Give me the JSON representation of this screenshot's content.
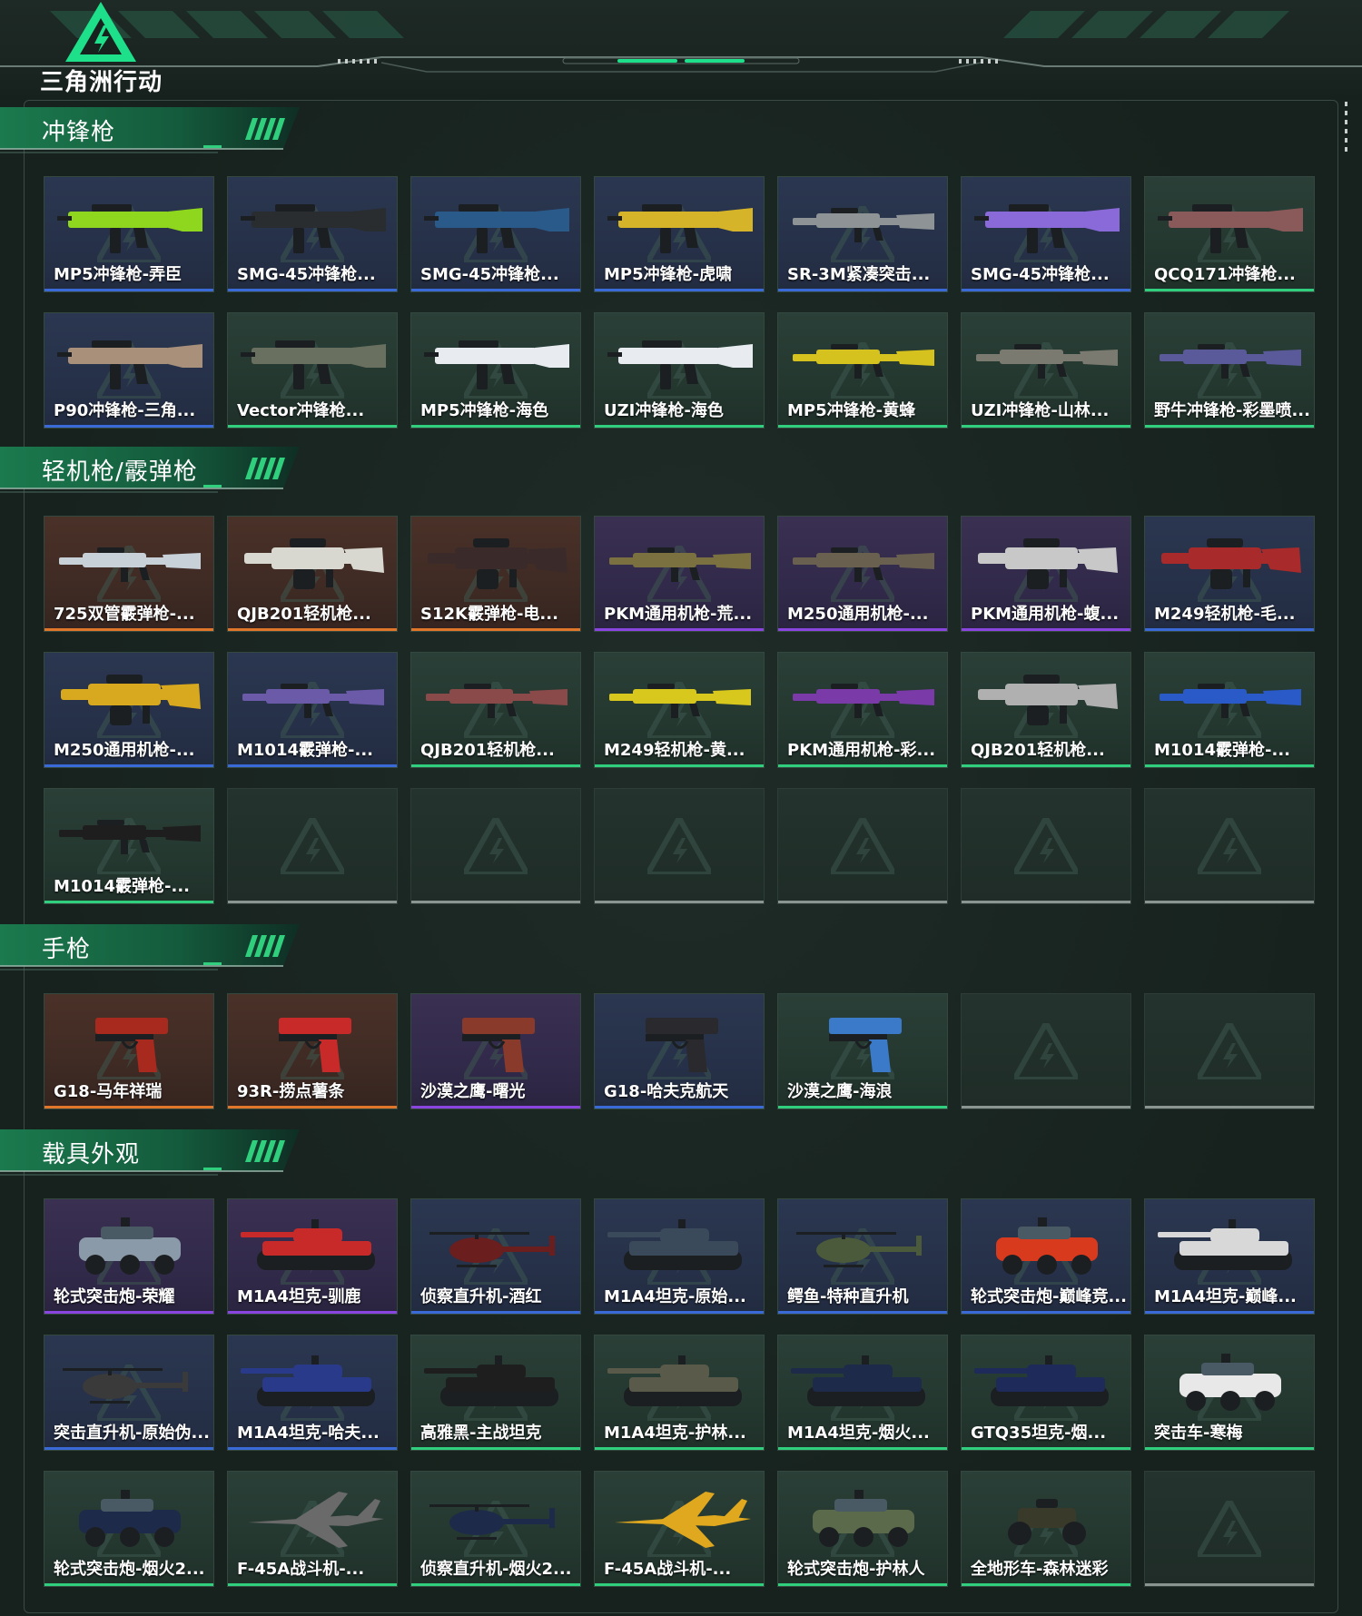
{
  "logo": {
    "text": "三角洲行动"
  },
  "colors": {
    "blue": "#3a6ad8",
    "purple": "#8a44e0",
    "orange": "#e0762a",
    "green": "#2fcf7d",
    "empty": "#8a9490",
    "accent": "#1ee08a"
  },
  "sections": [
    {
      "title": "冲锋枪",
      "items": [
        {
          "label": "MP5冲锋枪-弄臣",
          "quality": "blue",
          "kind": "smg",
          "tint": "#8fd61e"
        },
        {
          "label": "SMG-45冲锋枪...",
          "quality": "blue",
          "kind": "smg",
          "tint": "#2a2d30"
        },
        {
          "label": "SMG-45冲锋枪...",
          "quality": "blue",
          "kind": "smg",
          "tint": "#2a5a8a"
        },
        {
          "label": "MP5冲锋枪-虎啸",
          "quality": "blue",
          "kind": "smg",
          "tint": "#d6b42a"
        },
        {
          "label": "SR-3M紧凑突击...",
          "quality": "blue",
          "kind": "rifle",
          "tint": "#8e9496"
        },
        {
          "label": "SMG-45冲锋枪...",
          "quality": "blue",
          "kind": "smg",
          "tint": "#8a6ad8"
        },
        {
          "label": "QCQ171冲锋枪...",
          "quality": "green",
          "kind": "smg",
          "tint": "#8a5a5a"
        },
        {
          "label": "P90冲锋枪-三角...",
          "quality": "blue",
          "kind": "smg",
          "tint": "#a8907a"
        },
        {
          "label": "Vector冲锋枪...",
          "quality": "green",
          "kind": "smg",
          "tint": "#6a7060"
        },
        {
          "label": "MP5冲锋枪-海色",
          "quality": "green",
          "kind": "smg",
          "tint": "#e8ecf0"
        },
        {
          "label": "UZI冲锋枪-海色",
          "quality": "green",
          "kind": "smg",
          "tint": "#e8ecf0"
        },
        {
          "label": "MP5冲锋枪-黄蜂",
          "quality": "green",
          "kind": "rifle",
          "tint": "#d6c21e"
        },
        {
          "label": "UZI冲锋枪-山林...",
          "quality": "green",
          "kind": "rifle",
          "tint": "#7a7a70"
        },
        {
          "label": "野牛冲锋枪-彩墨喷...",
          "quality": "green",
          "kind": "rifle",
          "tint": "#5a5a9a"
        }
      ]
    },
    {
      "title": "轻机枪/霰弹枪",
      "items": [
        {
          "label": "725双管霰弹枪-...",
          "quality": "orange",
          "kind": "rifle",
          "tint": "#c8d0d8"
        },
        {
          "label": "QJB201轻机枪...",
          "quality": "orange",
          "kind": "lmg",
          "tint": "#d8d8d0"
        },
        {
          "label": "S12K霰弹枪-电...",
          "quality": "orange",
          "kind": "lmg",
          "tint": "#3a2a2a"
        },
        {
          "label": "PKM通用机枪-荒...",
          "quality": "purple",
          "kind": "rifle",
          "tint": "#7a7040"
        },
        {
          "label": "M250通用机枪-...",
          "quality": "purple",
          "kind": "rifle",
          "tint": "#6a6050"
        },
        {
          "label": "PKM通用机枪-蝮...",
          "quality": "purple",
          "kind": "lmg",
          "tint": "#c8c8c8"
        },
        {
          "label": "M249轻机枪-毛...",
          "quality": "blue",
          "kind": "lmg",
          "tint": "#a82a2a"
        },
        {
          "label": "M250通用机枪-...",
          "quality": "blue",
          "kind": "lmg",
          "tint": "#d8a81e"
        },
        {
          "label": "M1014霰弹枪-...",
          "quality": "blue",
          "kind": "rifle",
          "tint": "#6a5aa8"
        },
        {
          "label": "QJB201轻机枪...",
          "quality": "green",
          "kind": "rifle",
          "tint": "#8a4a4a"
        },
        {
          "label": "M249轻机枪-黄...",
          "quality": "green",
          "kind": "rifle",
          "tint": "#d8c81e"
        },
        {
          "label": "PKM通用机枪-彩...",
          "quality": "green",
          "kind": "rifle",
          "tint": "#7a3aa8"
        },
        {
          "label": "QJB201轻机枪...",
          "quality": "green",
          "kind": "lmg",
          "tint": "#b0b0b0"
        },
        {
          "label": "M1014霰弹枪-...",
          "quality": "green",
          "kind": "rifle",
          "tint": "#2a5ac8"
        },
        {
          "label": "M1014霰弹枪-...",
          "quality": "green",
          "kind": "rifle",
          "tint": "#1e1e1e"
        },
        {
          "label": "",
          "quality": "empty",
          "kind": "none",
          "tint": ""
        },
        {
          "label": "",
          "quality": "empty",
          "kind": "none",
          "tint": ""
        },
        {
          "label": "",
          "quality": "empty",
          "kind": "none",
          "tint": ""
        },
        {
          "label": "",
          "quality": "empty",
          "kind": "none",
          "tint": ""
        },
        {
          "label": "",
          "quality": "empty",
          "kind": "none",
          "tint": ""
        },
        {
          "label": "",
          "quality": "empty",
          "kind": "none",
          "tint": ""
        }
      ]
    },
    {
      "title": "手枪",
      "items": [
        {
          "label": "G18-马年祥瑞",
          "quality": "orange",
          "kind": "pistol",
          "tint": "#a82a1e"
        },
        {
          "label": "93R-捞点薯条",
          "quality": "orange",
          "kind": "pistol",
          "tint": "#c82a2a"
        },
        {
          "label": "沙漠之鹰-曙光",
          "quality": "purple",
          "kind": "pistol",
          "tint": "#8a3a2a"
        },
        {
          "label": "G18-哈夫克航天",
          "quality": "blue",
          "kind": "pistol",
          "tint": "#2a2a2e"
        },
        {
          "label": "沙漠之鹰-海浪",
          "quality": "green",
          "kind": "pistol",
          "tint": "#3a7ac8"
        },
        {
          "label": "",
          "quality": "empty",
          "kind": "none",
          "tint": ""
        },
        {
          "label": "",
          "quality": "empty",
          "kind": "none",
          "tint": ""
        }
      ]
    },
    {
      "title": "载具外观",
      "items": [
        {
          "label": "轮式突击炮-荣耀",
          "quality": "purple",
          "kind": "car",
          "tint": "#8a9aa8"
        },
        {
          "label": "M1A4坦克-驯鹿",
          "quality": "purple",
          "kind": "tank",
          "tint": "#c82a2a"
        },
        {
          "label": "侦察直升机-酒红",
          "quality": "blue",
          "kind": "heli",
          "tint": "#6a1e1e"
        },
        {
          "label": "M1A4坦克-原始...",
          "quality": "blue",
          "kind": "tank",
          "tint": "#3a4a5a"
        },
        {
          "label": "鳄鱼-特种直升机",
          "quality": "blue",
          "kind": "heli",
          "tint": "#4a5a3a"
        },
        {
          "label": "轮式突击炮-巅峰竞...",
          "quality": "blue",
          "kind": "car",
          "tint": "#d83a1e"
        },
        {
          "label": "M1A4坦克-巅峰...",
          "quality": "blue",
          "kind": "tank",
          "tint": "#d8d8d8"
        },
        {
          "label": "突击直升机-原始伪...",
          "quality": "blue",
          "kind": "heli",
          "tint": "#3a3a3a"
        },
        {
          "label": "M1A4坦克-哈夫...",
          "quality": "blue",
          "kind": "tank",
          "tint": "#2a3a8a"
        },
        {
          "label": "高雅黑-主战坦克",
          "quality": "green",
          "kind": "tank",
          "tint": "#1e1e1e"
        },
        {
          "label": "M1A4坦克-护林...",
          "quality": "green",
          "kind": "tank",
          "tint": "#5a5a4a"
        },
        {
          "label": "M1A4坦克-烟火...",
          "quality": "green",
          "kind": "tank",
          "tint": "#1e2a4a"
        },
        {
          "label": "GTQ35坦克-烟...",
          "quality": "green",
          "kind": "tank",
          "tint": "#1e2a5a"
        },
        {
          "label": "突击车-寒梅",
          "quality": "green",
          "kind": "car",
          "tint": "#e8e8e8"
        },
        {
          "label": "轮式突击炮-烟火2...",
          "quality": "green",
          "kind": "car",
          "tint": "#1e2a4a"
        },
        {
          "label": "F-45A战斗机-...",
          "quality": "green",
          "kind": "jet",
          "tint": "#6a6a6a"
        },
        {
          "label": "侦察直升机-烟火2...",
          "quality": "green",
          "kind": "heli",
          "tint": "#1e2a4a"
        },
        {
          "label": "F-45A战斗机-...",
          "quality": "green",
          "kind": "jet",
          "tint": "#e0a81e"
        },
        {
          "label": "轮式突击炮-护林人",
          "quality": "green",
          "kind": "car",
          "tint": "#5a6a4a"
        },
        {
          "label": "全地形车-森林迷彩",
          "quality": "green",
          "kind": "atv",
          "tint": "#3a3a2a"
        },
        {
          "label": "",
          "quality": "empty",
          "kind": "none",
          "tint": ""
        }
      ]
    }
  ]
}
